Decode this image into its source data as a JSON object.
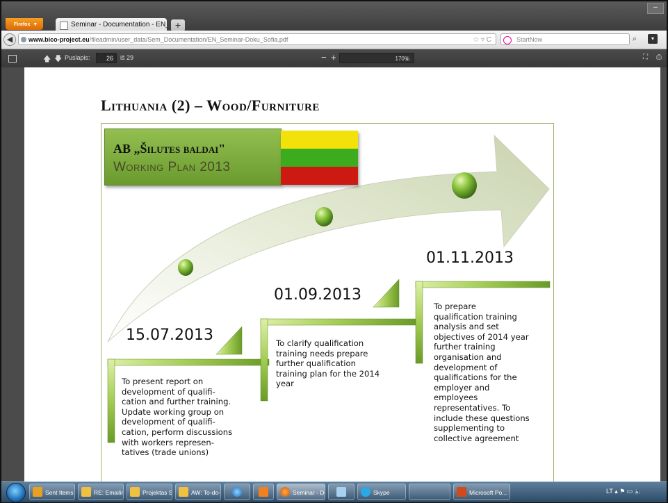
{
  "browser": {
    "menu_button": "Firefox",
    "tab_title": "Seminar - Documentation - EN_Seminar...",
    "new_tab": "+",
    "url_domain": "www.bico-project.eu",
    "url_path": "/fileadmin/user_data/Sem_Documentation/EN_Seminar-Doku_Sofia.pdf",
    "url_controls": "☆ ▿ C",
    "search_placeholder": "StartNow"
  },
  "pdf_toolbar": {
    "page_label": "Puslapis:",
    "page_current": "26",
    "page_of": "iš 29",
    "zoom": "170%",
    "zoom_out": "−",
    "zoom_in": "+"
  },
  "slide": {
    "title": "Lithuania (2) – Wood/Furniture",
    "company_line1": "AB „Šilutes baldai\"",
    "company_line2": "Working Plan 2013",
    "flag_colors": [
      "#f2e20a",
      "#3cac1e",
      "#cc1a12"
    ],
    "milestones": [
      {
        "date": "15.07.2013",
        "lines": [
          "To present report on",
          "development of qualifi-",
          "cation and further training.",
          "Update working group on",
          "development of qualifi-",
          "cation, perform discussions",
          "with workers represen-",
          "tatives (trade unions)"
        ]
      },
      {
        "date": "01.09.2013",
        "lines": [
          "To clarify qualification",
          "training needs prepare",
          "further qualification",
          "training plan for the 2014",
          "year"
        ]
      },
      {
        "date": "01.11.2013",
        "lines": [
          "To prepare",
          "qualification training",
          "analysis and set",
          "objectives of 2014 year",
          "further training",
          "organisation and",
          "development of",
          "qualifications for the",
          "employer and",
          "employees",
          "representatives. To",
          "include these questions",
          "supplementing to",
          "collective agreement"
        ]
      }
    ]
  },
  "taskbar": {
    "items": [
      "Sent Items - ...",
      "RE: Emailing: ...",
      "Projektas Soc...",
      "AW: To-do-lis...",
      "Seminar - Doc...",
      "Skype",
      "Microsoft Po..."
    ],
    "lang": "LT"
  }
}
